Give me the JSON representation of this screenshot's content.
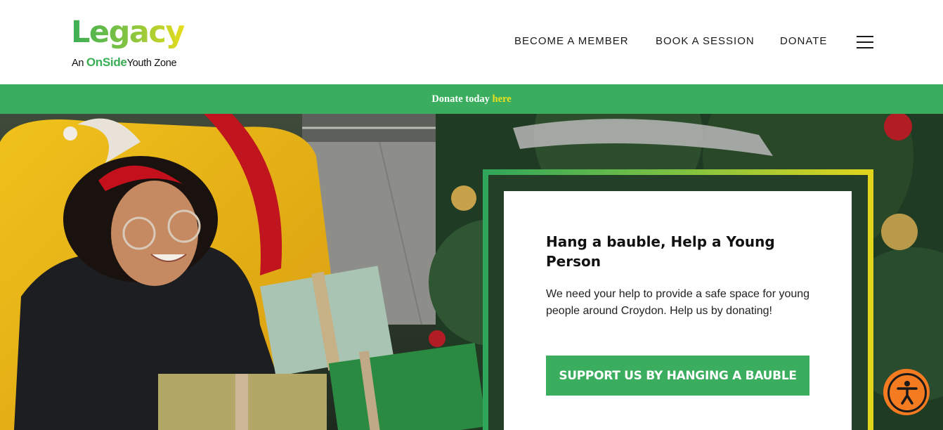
{
  "logo": {
    "wordmark": "Legacy",
    "tagline_prefix": "An",
    "tagline_brand": "OnSide",
    "tagline_suffix": "Youth Zone"
  },
  "nav": {
    "items": [
      {
        "label": "BECOME A MEMBER"
      },
      {
        "label": "BOOK A SESSION"
      },
      {
        "label": "DONATE"
      }
    ],
    "menu_icon": "hamburger-menu-icon"
  },
  "banner": {
    "text": "Donate today",
    "link_text": "here"
  },
  "hero": {
    "card": {
      "title": "Hang a bauble, Help a Young Person",
      "body": "We need your help to provide a safe space for young people around Croydon. Help us by donating!",
      "button_label": "SUPPORT US BY HANGING A BAUBLE"
    }
  },
  "accessibility": {
    "icon": "accessibility-icon"
  },
  "colors": {
    "brand_green": "#3aae5e",
    "banner_link": "#e9e022",
    "accessibility_orange": "#f47b20"
  }
}
